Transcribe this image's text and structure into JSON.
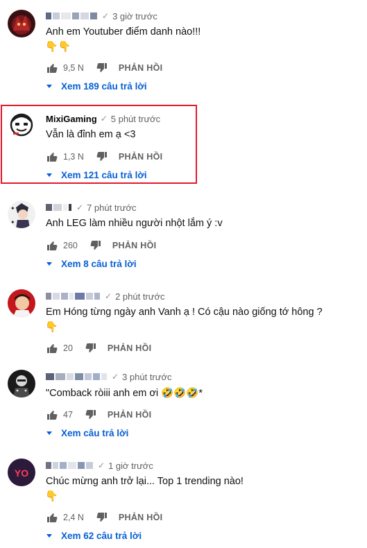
{
  "comments": [
    {
      "author": "",
      "time": "3 giờ trước",
      "text": "Anh em Youtuber điểm danh nào!!!",
      "reactions": "👇👇",
      "likes": "9,5 N",
      "reply_label": "PHẢN HỒI",
      "view_replies": "Xem 189 câu trả lời"
    },
    {
      "author": "MixiGaming",
      "time": "5 phút trước",
      "text": "Vẫn là đỉnh em ạ <3",
      "likes": "1,3 N",
      "reply_label": "PHẢN HỒI",
      "view_replies": "Xem 121 câu trả lời"
    },
    {
      "author": "",
      "time": "7 phút trước",
      "text": "Anh LEG làm nhiều người nhột lắm ý :v",
      "likes": "260",
      "reply_label": "PHẢN HỒI",
      "view_replies": "Xem 8 câu trả lời"
    },
    {
      "author": "",
      "time": "2 phút trước",
      "text": "Em Hóng từng ngày anh Vanh ạ ! Có cậu nào giống tớ hông ?",
      "reactions": "👇",
      "likes": "20",
      "reply_label": "PHẢN HỒI"
    },
    {
      "author": "",
      "time": "3 phút trước",
      "text": "\"Comback ròiii anh em ơi 🤣🤣🤣*",
      "likes": "47",
      "reply_label": "PHẢN HỒI",
      "view_replies": "Xem câu trả lời"
    },
    {
      "author": "",
      "time": "1 giờ trước",
      "text": "Chúc mừng anh trở lại... Top 1 trending nào!",
      "reactions": "👇",
      "likes": "2,4 N",
      "reply_label": "PHẢN HỒI",
      "view_replies": "Xem 62 câu trả lời"
    }
  ],
  "avatars": {
    "c1": "YO",
    "c6": "YO"
  },
  "colors": {
    "link_blue": "#065fd4",
    "highlight_red": "#e3182a",
    "meta_gray": "#606060"
  }
}
